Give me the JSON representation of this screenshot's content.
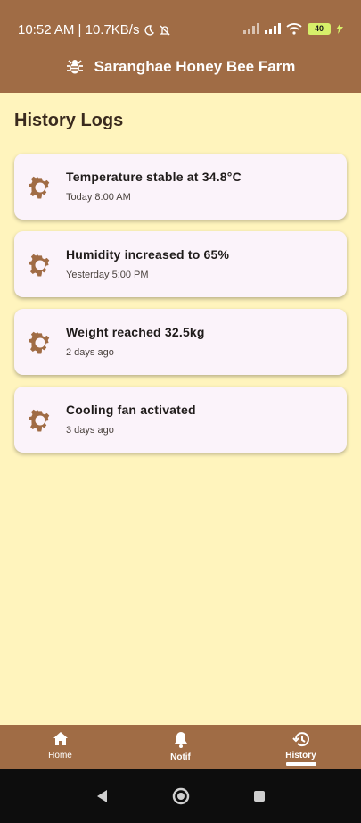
{
  "status": {
    "time_text": "10:52 AM | 10.7KB/s",
    "battery": "40"
  },
  "appbar": {
    "title": "Saranghae Honey Bee Farm",
    "icon": "bug-icon"
  },
  "page_title": "History Logs",
  "logs": [
    {
      "title": "Temperature stable at 34.8°C",
      "time": "Today 8:00 AM",
      "icon": "gear-icon"
    },
    {
      "title": "Humidity increased to 65%",
      "time": "Yesterday 5:00 PM",
      "icon": "gear-icon"
    },
    {
      "title": "Weight reached 32.5kg",
      "time": "2 days ago",
      "icon": "gear-icon"
    },
    {
      "title": "Cooling fan activated",
      "time": "3 days ago",
      "icon": "gear-icon"
    }
  ],
  "bottom_nav": {
    "items": [
      {
        "label": "Home",
        "icon": "home-icon"
      },
      {
        "label": "Notif",
        "icon": "bell-icon"
      },
      {
        "label": "History",
        "icon": "history-icon",
        "active": true
      }
    ]
  },
  "colors": {
    "brand": "#a06c45",
    "background": "#fff4bd",
    "card": "#fbf3fa"
  }
}
